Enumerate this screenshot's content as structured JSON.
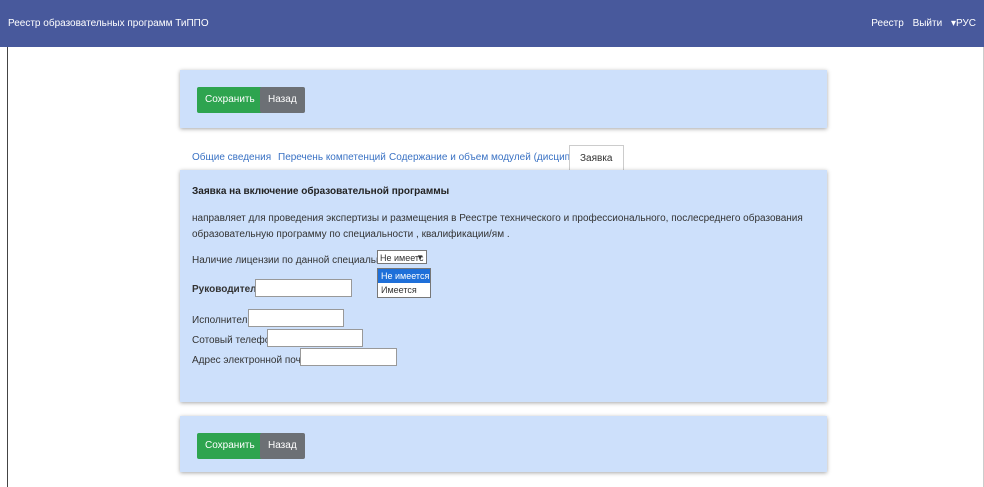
{
  "navbar": {
    "brand": "Реестр образовательных программ ТиППО",
    "registry": "Реестр",
    "logout": "Выйти",
    "lang": "▾РУС"
  },
  "actions": {
    "save": "Сохранить",
    "back": "Назад"
  },
  "tabs": [
    {
      "label": "Общие сведения"
    },
    {
      "label": "Перечень компетенций"
    },
    {
      "label": "Содержание и объем модулей (дисциплин)"
    },
    {
      "label": "Заявка"
    }
  ],
  "form": {
    "title": "Заявка на включение образовательной программы",
    "description": "направляет для проведения экспертизы и размещения в Реестре технического и профессионального, послесреднего образования образовательную программу по специальности , квалификации/ям .",
    "license_label": "Наличие лицензии по данной специальности:",
    "license_value": "Не имеетс",
    "license_options": [
      "Не имеется",
      "Имеется"
    ],
    "head_label": "Руководитель",
    "executor_label": "Исполнитель",
    "phone_label": "Сотовый телефон",
    "email_label": "Адрес электронной почты"
  }
}
